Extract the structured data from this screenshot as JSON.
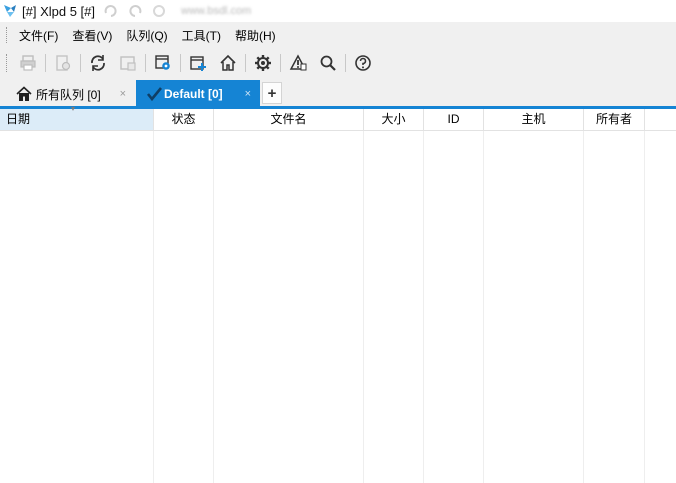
{
  "window": {
    "title": "[#] Xlpd 5 [#]",
    "blurred_url": "www.bsdl.com"
  },
  "menu": {
    "items": [
      {
        "label": "文件(F)"
      },
      {
        "label": "查看(V)"
      },
      {
        "label": "队列(Q)"
      },
      {
        "label": "工具(T)"
      },
      {
        "label": "帮助(H)"
      }
    ]
  },
  "toolbar": {
    "icons": [
      "print-icon",
      "print-settings-icon",
      "refresh-icon",
      "window-icon",
      "queue-settings-icon",
      "new-queue-icon",
      "home-icon",
      "gear-icon",
      "alert-icon",
      "search-icon",
      "help-icon"
    ]
  },
  "tabs": {
    "all": {
      "label": "所有队列 [0]",
      "close": "×"
    },
    "default": {
      "label": "Default [0]",
      "close": "×"
    },
    "add": "+"
  },
  "table": {
    "columns": [
      "日期",
      "状态",
      "文件名",
      "大小",
      "ID",
      "主机",
      "所有者"
    ],
    "rows": []
  },
  "colors": {
    "accent": "#1584d4",
    "menubar_bg": "#f0f0f0",
    "selected_header": "#dcecf8"
  }
}
